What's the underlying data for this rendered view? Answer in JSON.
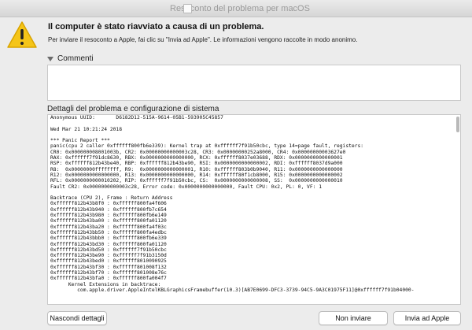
{
  "window": {
    "title": "Resoconto del problema per macOS"
  },
  "alert": {
    "heading": "Il computer è stato riavviato a causa di un problema.",
    "subtext": "Per inviare il resoconto a Apple, fai clic su \"Invia ad Apple\". Le informazioni vengono raccolte in modo anonimo."
  },
  "comments": {
    "label": "Commenti",
    "value": ""
  },
  "details": {
    "label": "Dettagli del problema e configurazione di sistema",
    "lines": [
      "Anonymous UUID:       D6182D12-515A-9614-05B1-593905C45857",
      "",
      "Wed Mar 21 10:21:24 2018",
      "",
      "*** Panic Report ***",
      "panic(cpu 2 caller 0xffffff800fb6e339): Kernel trap at 0xffffff7f91b50cbc, type 14=page fault, registers:",
      "CR0: 0x000000008001003b, CR2: 0x00000000000003c28, CR3: 0x00000000252a8000, CR4: 0x00000000003627e0",
      "RAX: 0xffffff7f91dc8630, RBX: 0x0000000000000000, RCX: 0xffffff8037e03688, RDX: 0x0000000000000001",
      "RSP: 0xffffff812b43be40, RBP: 0xffffff812b43be90, RSI: 0x0000000000000002, RDI: 0xffffff8037d9a000",
      "R8:  0x00000000ffffffff, R9:  0x0000000000000001, R10: 0xffffff803b0b9040, R11: 0x0000000000000000",
      "R12: 0x0000000000000000, R13: 0x0000000000000000, R14: 0xffffff80f1cb8000, R15: 0x0000000000000002",
      "RFL: 0x0000000000010202, RIP: 0xffffff7f91b50cbc, CS:  0x0000000000000008, SS:  0x0000000000000010",
      "Fault CR2: 0x0000000000003c28, Error code: 0x0000000000000000, Fault CPU: 0x2, PL: 0, VF: 1",
      "",
      "Backtrace (CPU 2), Frame : Return Address",
      "0xffffff812b43b8f0 : 0xffffff800fa4f606",
      "0xffffff812b43b940 : 0xffffff800fb7c654",
      "0xffffff812b43b980 : 0xffffff800fb6e149",
      "0xffffff812b43ba00 : 0xffffff800fa01120",
      "0xffffff812b43ba20 : 0xffffff800fa4f03c",
      "0xffffff812b43bb50 : 0xffffff800fa4edbc",
      "0xffffff812b43bbb0 : 0xffffff800fb6e339",
      "0xffffff812b43bd30 : 0xffffff800fa01120",
      "0xffffff812b43bd50 : 0xffffff7f91b50cbc",
      "0xffffff812b43be90 : 0xffffff7f91b3150d",
      "0xffffff812b43bed0 : 0xffffff8010090925",
      "0xffffff812b43bf30 : 0xffffff801008f132",
      "0xffffff812b43bf70 : 0xffffff801008e76c",
      "0xffffff812b43bfa0 : 0xffffff800fa004f7",
      "      Kernel Extensions in backtrace:",
      "         com.apple.driver.AppleIntelKBLGraphicsFramebuffer(10.3)[AB7E0699-DFC3-3739-94C5-9A3C01975F11]@0xffffff7f91b04000-"
    ]
  },
  "buttons": {
    "hide_details": "Nascondi dettagli",
    "dont_send": "Non inviare",
    "send": "Invia ad Apple"
  },
  "colors": {
    "window_bg": "#ececec",
    "warning_yellow": "#f5c518"
  }
}
